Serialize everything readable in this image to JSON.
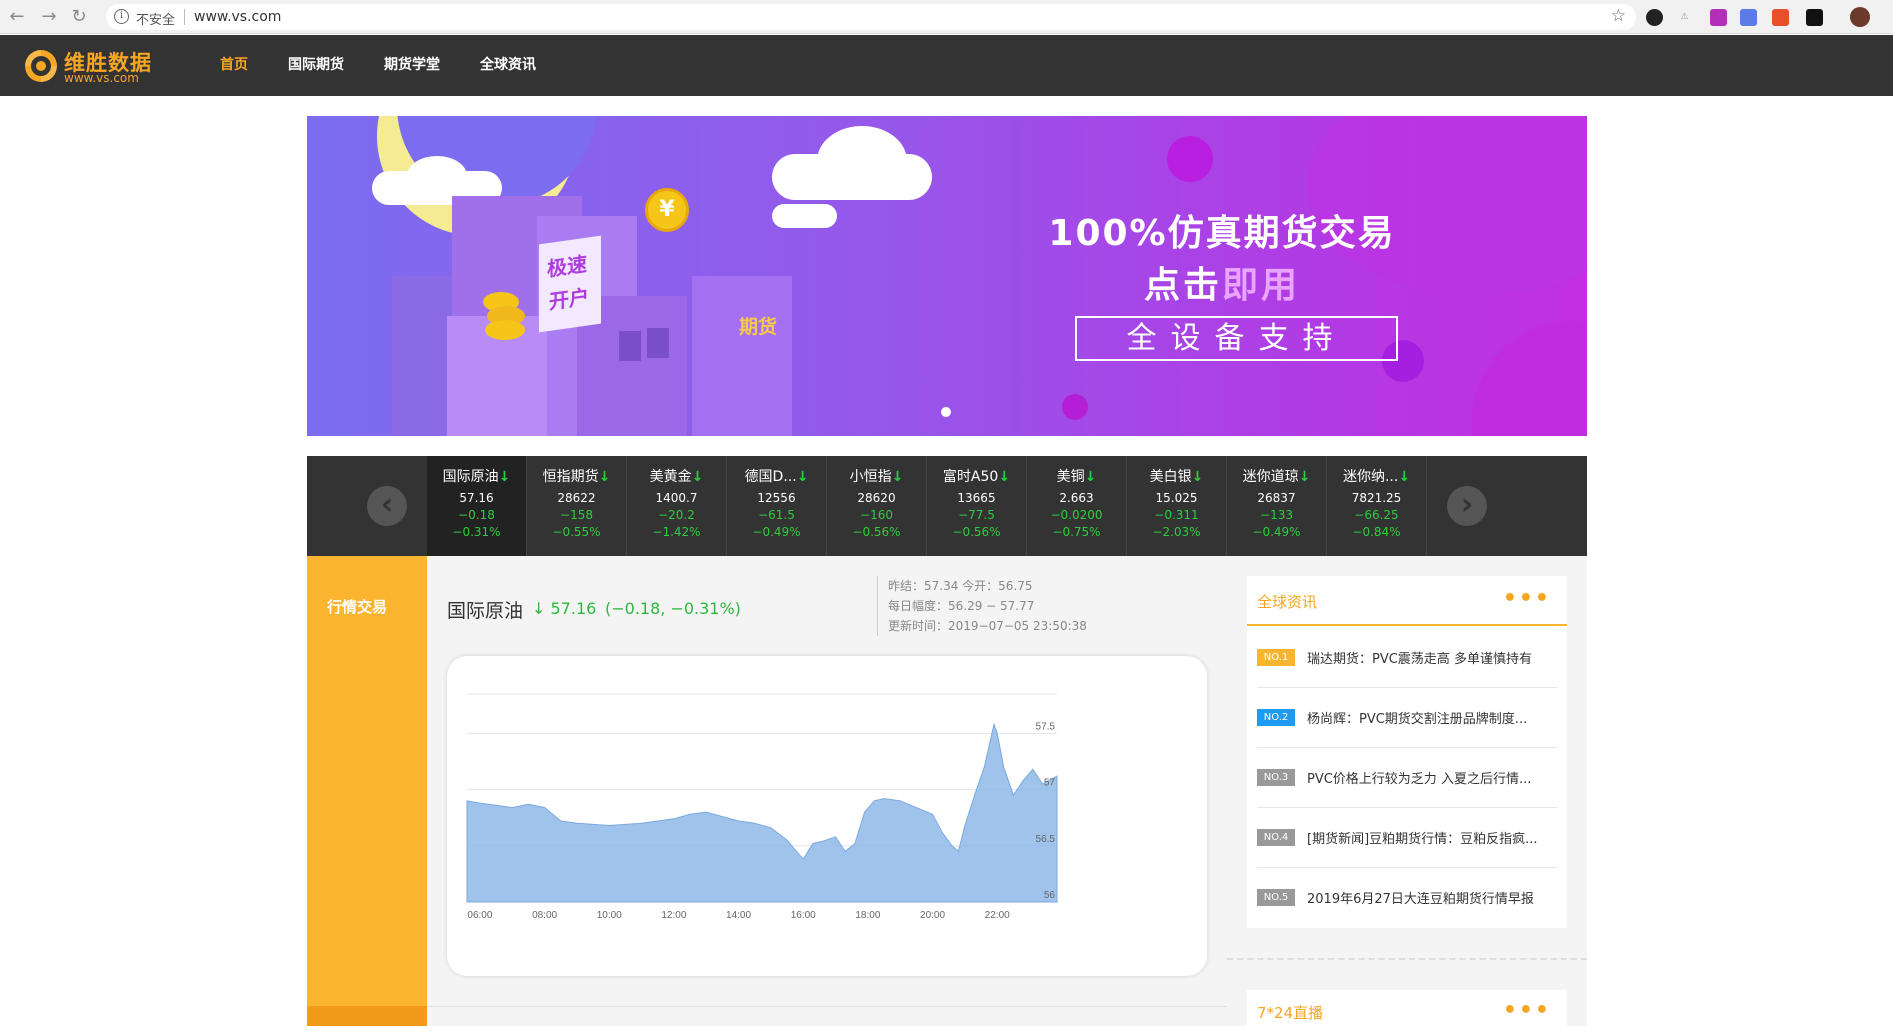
{
  "browser": {
    "insecure_label": "不安全",
    "url": "www.vs.com"
  },
  "header": {
    "logo_cn": "维胜数据",
    "logo_en": "www.vs.com",
    "nav": [
      {
        "label": "首页",
        "active": true
      },
      {
        "label": "国际期货",
        "active": false
      },
      {
        "label": "期货学堂",
        "active": false
      },
      {
        "label": "全球资讯",
        "active": false
      }
    ]
  },
  "banner": {
    "title": "100%仿真期货交易",
    "sub_a": "点击",
    "sub_b": "即用",
    "box": "全设备支持",
    "bldg_tag_a": "极速",
    "bldg_tag_b": "开户",
    "bldg_label": "期货",
    "coin_symbol": "¥"
  },
  "ticker": {
    "items": [
      {
        "name": "国际原油",
        "arrow": "↓",
        "price": "57.16",
        "chg": "−0.18",
        "pct": "−0.31%"
      },
      {
        "name": "恒指期货",
        "arrow": "↓",
        "price": "28622",
        "chg": "−158",
        "pct": "−0.55%"
      },
      {
        "name": "美黄金",
        "arrow": "↓",
        "price": "1400.7",
        "chg": "−20.2",
        "pct": "−1.42%"
      },
      {
        "name": "德国D...",
        "arrow": "↓",
        "price": "12556",
        "chg": "−61.5",
        "pct": "−0.49%"
      },
      {
        "name": "小恒指",
        "arrow": "↓",
        "price": "28620",
        "chg": "−160",
        "pct": "−0.56%"
      },
      {
        "name": "富时A50",
        "arrow": "↓",
        "price": "13665",
        "chg": "−77.5",
        "pct": "−0.56%"
      },
      {
        "name": "美铜",
        "arrow": "↓",
        "price": "2.663",
        "chg": "−0.0200",
        "pct": "−0.75%"
      },
      {
        "name": "美白银",
        "arrow": "↓",
        "price": "15.025",
        "chg": "−0.311",
        "pct": "−2.03%"
      },
      {
        "name": "迷你道琼",
        "arrow": "↓",
        "price": "26837",
        "chg": "−133",
        "pct": "−0.49%"
      },
      {
        "name": "迷你纳...",
        "arrow": "↓",
        "price": "7821.25",
        "chg": "−66.25",
        "pct": "−0.84%"
      }
    ]
  },
  "side_tab": {
    "label": "行情交易"
  },
  "market": {
    "name": "国际原油",
    "arrow": "↓",
    "price": "57.16",
    "change": "(−0.18,  −0.31%)",
    "prev_close": "昨结：57.34   今开：56.75",
    "range": "每日幅度：56.29 − 57.77",
    "updated": "更新时间：2019−07−05 23:50:38"
  },
  "chart_data": {
    "type": "area",
    "title": "",
    "xlabel": "",
    "ylabel": "",
    "x_ticks": [
      "06:00",
      "08:00",
      "10:00",
      "12:00",
      "14:00",
      "16:00",
      "18:00",
      "20:00",
      "22:00"
    ],
    "y_ticks": [
      56,
      56.5,
      57,
      57.5
    ],
    "ylim": [
      56,
      57.85
    ],
    "xlim_hours": [
      5.6,
      23.85
    ],
    "grid": true,
    "color": "#8fb9e8",
    "series": [
      {
        "x": [
          5.6,
          6.0,
          6.5,
          7.0,
          7.5,
          8.0,
          8.5,
          9.0,
          9.5,
          10.0,
          10.5,
          11.0,
          11.5,
          12.0,
          12.5,
          13.0,
          13.5,
          14.0,
          14.5,
          15.0,
          15.5,
          16.0,
          16.3,
          16.6,
          17.0,
          17.3,
          17.6,
          17.9,
          18.2,
          18.5,
          19.0,
          19.5,
          20.0,
          20.3,
          20.6,
          20.8,
          21.0,
          21.3,
          21.6,
          21.9,
          22.0,
          22.2,
          22.5,
          22.8,
          23.1,
          23.4,
          23.85
        ],
        "values": [
          56.9,
          56.88,
          56.86,
          56.84,
          56.87,
          56.84,
          56.72,
          56.7,
          56.69,
          56.68,
          56.69,
          56.7,
          56.72,
          56.74,
          56.78,
          56.8,
          56.76,
          56.72,
          56.7,
          56.66,
          56.55,
          56.38,
          56.52,
          56.54,
          56.58,
          56.45,
          56.52,
          56.8,
          56.9,
          56.92,
          56.9,
          56.84,
          56.78,
          56.62,
          56.5,
          56.45,
          56.68,
          56.95,
          57.2,
          57.58,
          57.5,
          57.2,
          56.95,
          57.08,
          57.18,
          57.05,
          57.12
        ]
      }
    ]
  },
  "news": {
    "title": "全球资讯",
    "more": "•••",
    "items": [
      {
        "badge": "NO.1",
        "color": "#fbb42f",
        "text": "瑞达期货：PVC震荡走高 多单谨慎持有"
      },
      {
        "badge": "NO.2",
        "color": "#1e9af0",
        "text": "杨尚辉：PVC期货交割注册品牌制度..."
      },
      {
        "badge": "NO.3",
        "color": "#999999",
        "text": "PVC价格上行较为乏力 入夏之后行情..."
      },
      {
        "badge": "NO.4",
        "color": "#999999",
        "text": "[期货新闻]豆粕期货行情：豆粕反指疯..."
      },
      {
        "badge": "NO.5",
        "color": "#999999",
        "text": "2019年6月27日大连豆粕期货行情早报"
      }
    ]
  },
  "live": {
    "title": "7*24直播",
    "more": "•••"
  }
}
